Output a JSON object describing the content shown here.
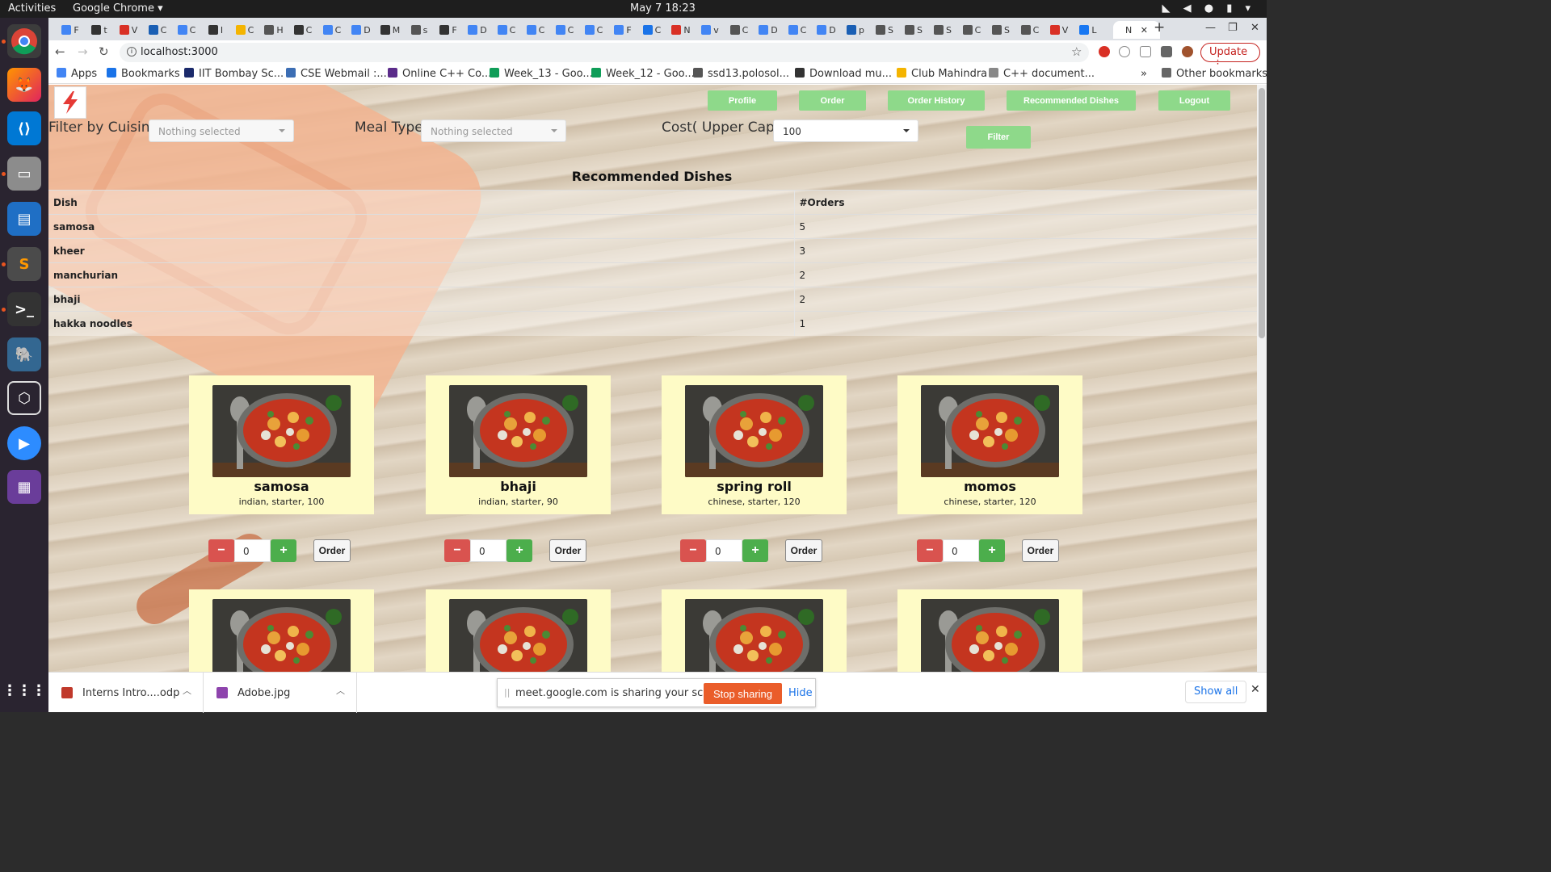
{
  "system": {
    "activities": "Activities",
    "app_name": "Google Chrome",
    "clock": "May 7  18:23"
  },
  "browser": {
    "address": "localhost:3000",
    "update_label": "Update",
    "bookmarks": [
      {
        "label": "Apps",
        "color": "#4285f4"
      },
      {
        "label": "Bookmarks",
        "color": "#1a73e8"
      },
      {
        "label": "IIT Bombay Sc...",
        "color": "#1b2a6b"
      },
      {
        "label": "CSE Webmail :...",
        "color": "#3c6eb4"
      },
      {
        "label": "Online C++ Co...",
        "color": "#5b2b8a"
      },
      {
        "label": "Week_13 - Goo...",
        "color": "#0f9d58"
      },
      {
        "label": "Week_12 - Goo...",
        "color": "#0f9d58"
      },
      {
        "label": "ssd13.polosol...",
        "color": "#555555"
      },
      {
        "label": "Download mu...",
        "color": "#333333"
      },
      {
        "label": "Club Mahindra",
        "color": "#f4b400"
      },
      {
        "label": "C++ document...",
        "color": "#888888"
      }
    ],
    "other_bookmarks": "Other bookmarks"
  },
  "navbar": {
    "profile": "Profile",
    "order": "Order",
    "order_history": "Order History",
    "recommended": "Recommended Dishes",
    "logout": "Logout"
  },
  "filters": {
    "cuisine_label": "Filter by Cuisine",
    "cuisine_value": "Nothing selected",
    "meal_label": "Meal Type",
    "meal_value": "Nothing selected",
    "cost_label": "Cost( Upper Cap)",
    "cost_value": "100",
    "filter_button": "Filter"
  },
  "recommended": {
    "title": "Recommended Dishes",
    "headers": [
      "Dish",
      "#Orders"
    ],
    "rows": [
      {
        "dish": "samosa",
        "orders": "5"
      },
      {
        "dish": "kheer",
        "orders": "3"
      },
      {
        "dish": "manchurian",
        "orders": "2"
      },
      {
        "dish": "bhaji",
        "orders": "2"
      },
      {
        "dish": "hakka noodles",
        "orders": "1"
      }
    ]
  },
  "dishes": [
    {
      "name": "samosa",
      "desc": "indian, starter, 100",
      "qty": "0",
      "order_label": "Order"
    },
    {
      "name": "bhaji",
      "desc": "indian, starter, 90",
      "qty": "0",
      "order_label": "Order"
    },
    {
      "name": "spring roll",
      "desc": "chinese, starter, 120",
      "qty": "0",
      "order_label": "Order"
    },
    {
      "name": "momos",
      "desc": "chinese, starter, 120",
      "qty": "0",
      "order_label": "Order"
    }
  ],
  "qty_controls": {
    "minus": "−",
    "plus": "+"
  },
  "downloads": {
    "items": [
      {
        "label": "Interns Intro....odp",
        "color": "#c0392b"
      },
      {
        "label": "Adobe.jpg",
        "color": "#8e44ad"
      }
    ],
    "share_message": "meet.google.com is sharing your screen.",
    "stop_sharing": "Stop sharing",
    "hide": "Hide",
    "show_all": "Show all"
  },
  "colors": {
    "nav_green": "#8ed98a",
    "card_bg": "#fefbc6",
    "minus_red": "#d9534f",
    "plus_green": "#4cae4c"
  }
}
